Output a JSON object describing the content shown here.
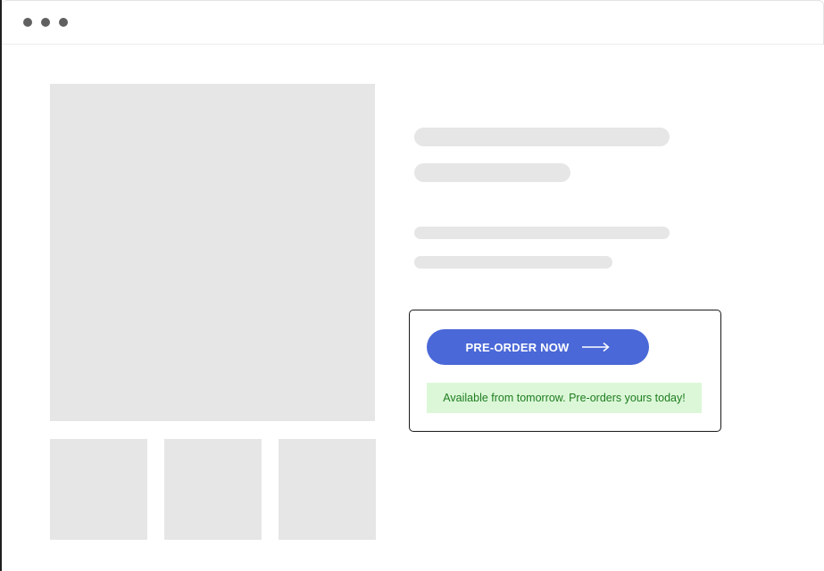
{
  "window": {
    "controls": [
      "window-dot",
      "window-dot",
      "window-dot"
    ]
  },
  "preorder": {
    "button_label": "PRE-ORDER NOW",
    "button_icon": "arrow-right-icon",
    "availability_text": "Available from tomorrow. Pre-orders yours today!",
    "accent_color": "#4a68d7",
    "note_bg_color": "#dcf7d8",
    "note_text_color": "#1e7d20"
  }
}
